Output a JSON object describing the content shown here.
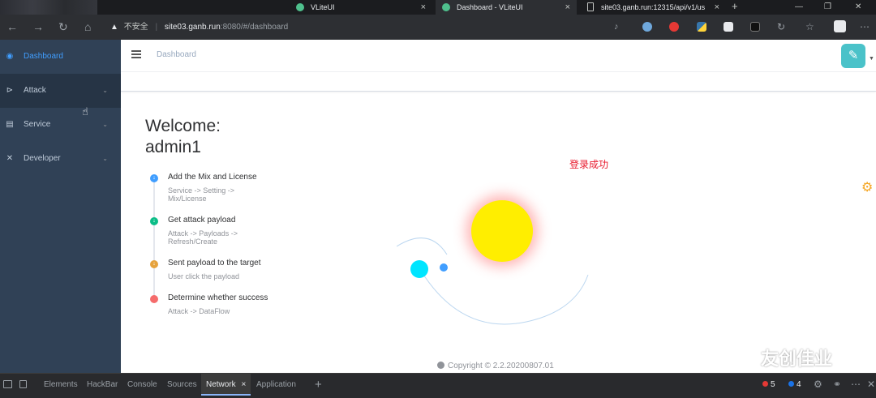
{
  "browser": {
    "tabs": [
      {
        "label": "VLiteUI",
        "active": false
      },
      {
        "label": "Dashboard - VLiteUI",
        "active": true
      },
      {
        "label": "site03.ganb.run:12315/api/v1/us",
        "active": false
      }
    ],
    "url_security": "不安全",
    "url_host": "site03.ganb.run",
    "url_rest": ":8080/#/dashboard"
  },
  "sidebar": {
    "items": [
      {
        "label": "Dashboard",
        "icon": "dashboard-icon",
        "active": true
      },
      {
        "label": "Attack",
        "icon": "attack-icon",
        "active": false
      },
      {
        "label": "Service",
        "icon": "service-icon",
        "active": false
      },
      {
        "label": "Developer",
        "icon": "developer-icon",
        "active": false
      }
    ]
  },
  "navbar": {
    "breadcrumb": "Dashboard"
  },
  "welcome": {
    "line1": "Welcome:",
    "line2": "admin1"
  },
  "timeline": [
    {
      "title": "Add the Mix and License",
      "sub": "Service -> Setting -> Mix/License",
      "color": "#409eff",
      "icon": "arrow-down-icon"
    },
    {
      "title": "Get attack payload",
      "sub": "Attack -> Payloads -> Refresh/Create",
      "color": "#0bbd87",
      "icon": "arrow-down-icon"
    },
    {
      "title": "Sent payload to the target",
      "sub": "User click the payload",
      "color": "#e6a23c",
      "icon": "arrow-down-icon"
    },
    {
      "title": "Determine whether success",
      "sub": "Attack -> DataFlow",
      "color": "#f56c6c",
      "icon": "dot-icon"
    }
  ],
  "toast": "登录成功",
  "footer": {
    "copyright": "Copyright © 2.2.20200807.01"
  },
  "watermark": "友创佳业",
  "devtools": {
    "tabs": [
      "Elements",
      "HackBar",
      "Console",
      "Sources",
      "Network",
      "Application"
    ],
    "active_tab": "Network",
    "errors": "5",
    "messages": "4"
  },
  "colors": {
    "sidebar_bg": "#304156",
    "active": "#409eff",
    "toast": "#e8192c",
    "sun": "#ffee00",
    "planet": "#00e5ff"
  }
}
